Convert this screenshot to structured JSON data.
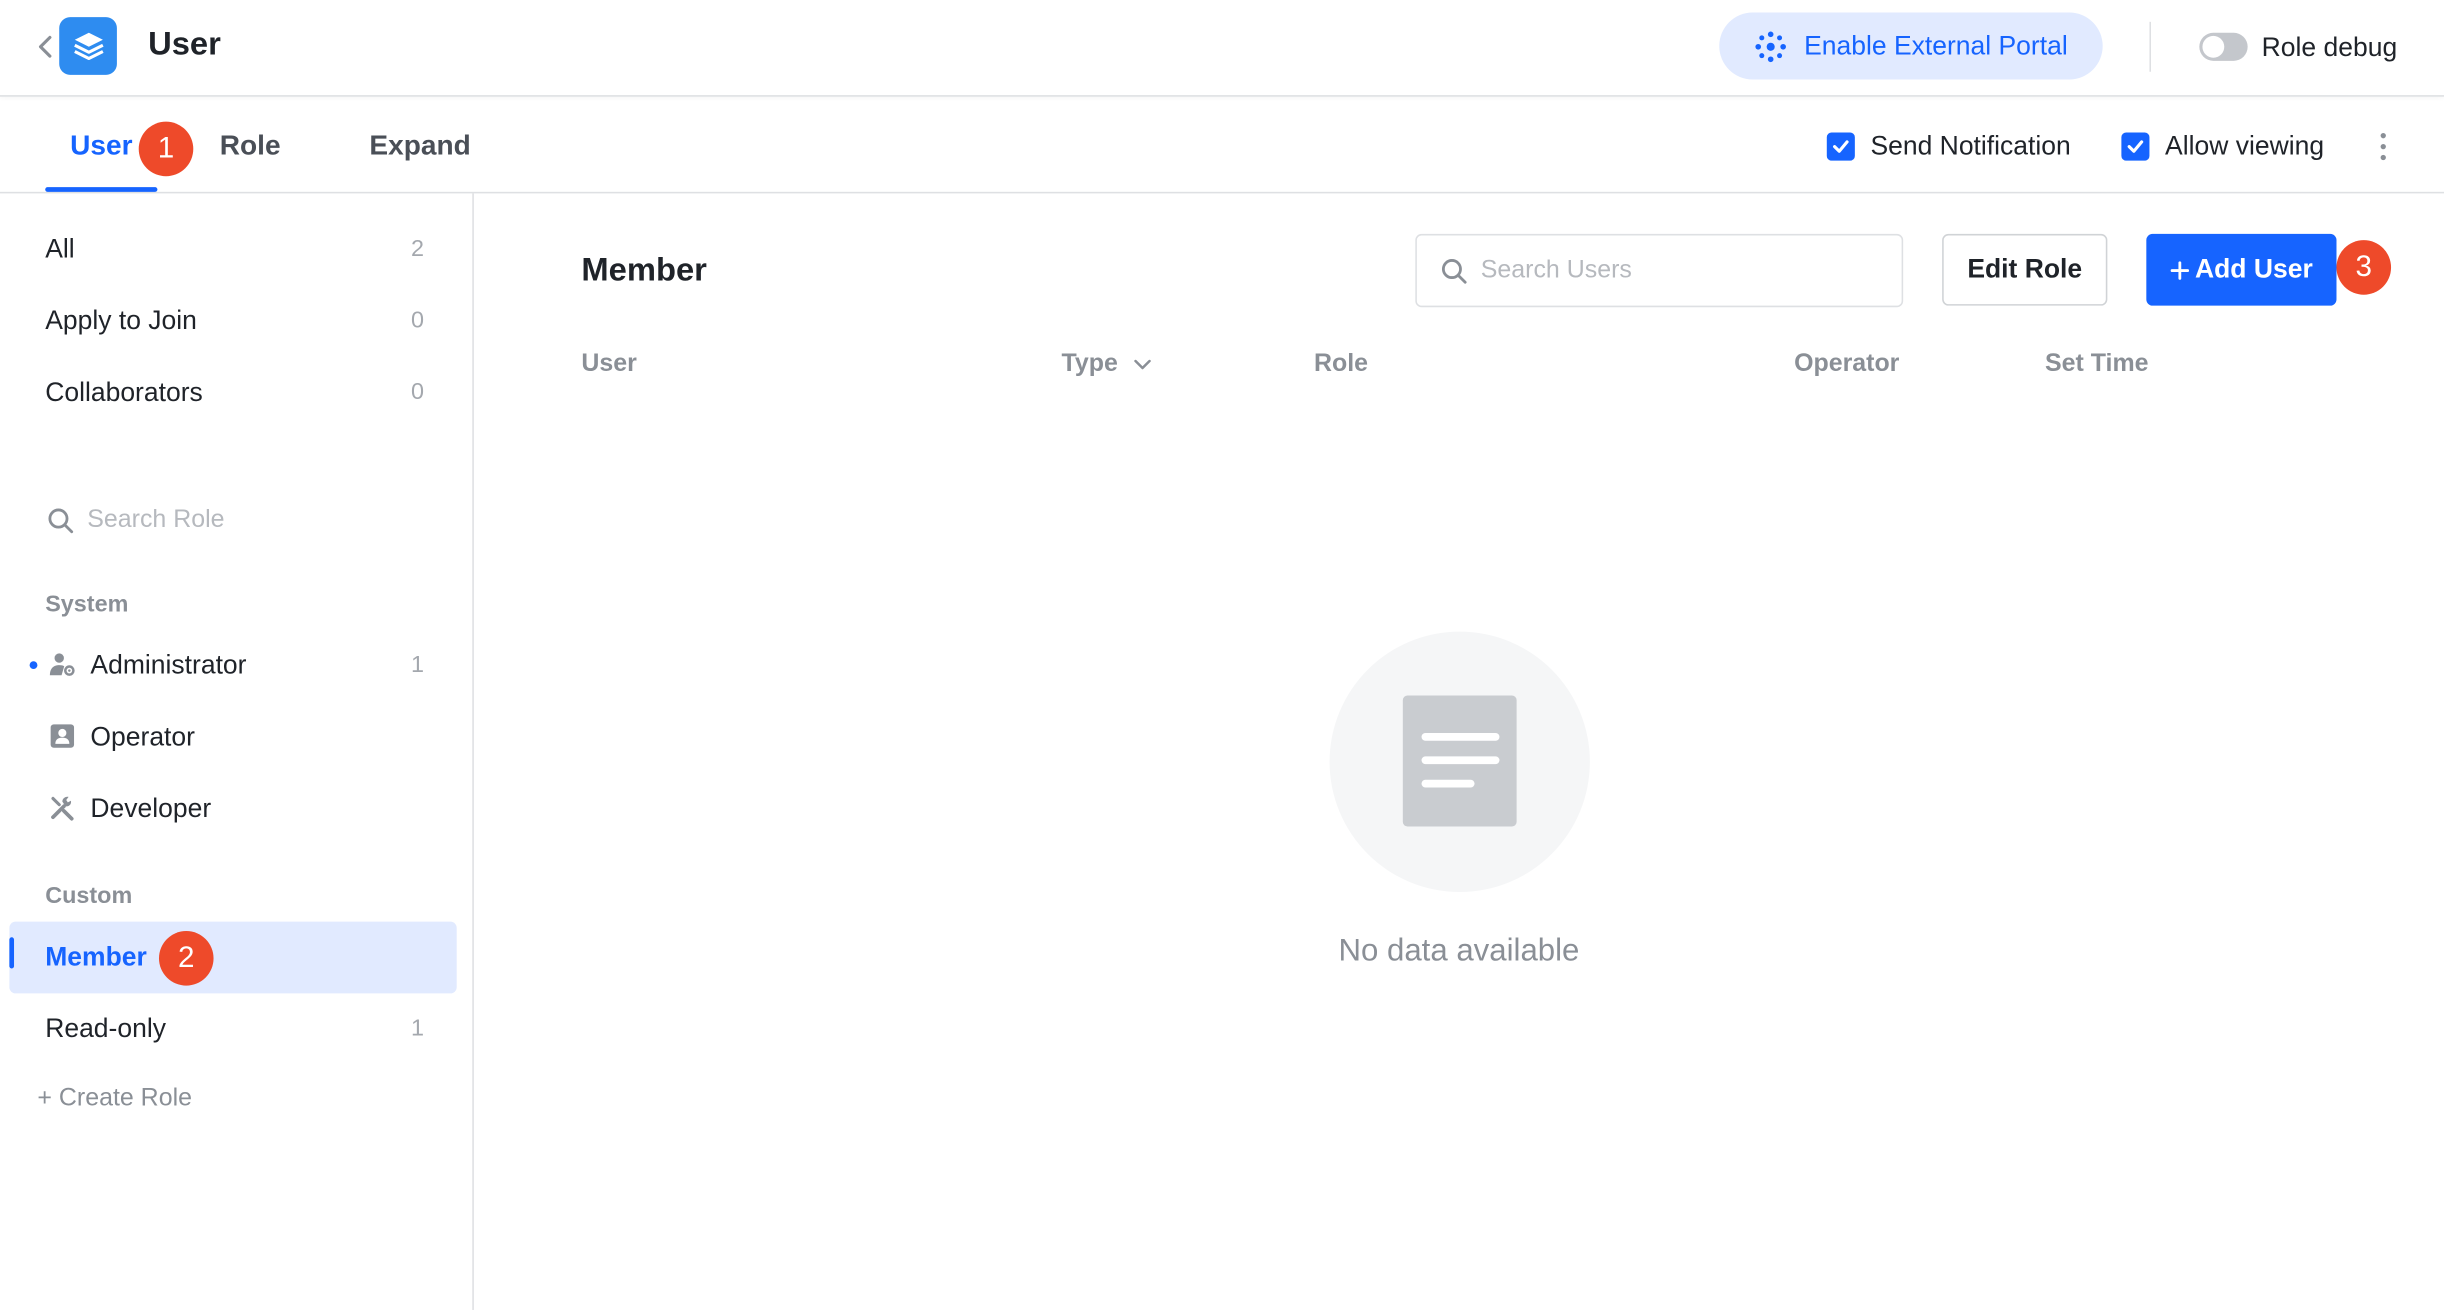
{
  "header": {
    "title": "User",
    "back_icon": "chevron-left-icon",
    "app_icon": "cube-icon",
    "portal_button": "Enable External Portal",
    "portal_icon": "portal-dots-icon",
    "role_debug_label": "Role debug",
    "role_debug_on": false
  },
  "tabs": {
    "items": [
      {
        "label": "User",
        "active": true
      },
      {
        "label": "Role",
        "active": false
      },
      {
        "label": "Expand",
        "active": false
      }
    ],
    "send_notification": {
      "label": "Send Notification",
      "checked": true
    },
    "allow_viewing": {
      "label": "Allow viewing",
      "checked": true
    }
  },
  "markers": [
    "1",
    "2",
    "3"
  ],
  "sidebar": {
    "filters": [
      {
        "label": "All",
        "count": "2"
      },
      {
        "label": "Apply to Join",
        "count": "0"
      },
      {
        "label": "Collaborators",
        "count": "0"
      }
    ],
    "search_placeholder": "Search Role",
    "system_title": "System",
    "system_roles": [
      {
        "label": "Administrator",
        "count": "1",
        "icon": "user-gear-icon"
      },
      {
        "label": "Operator",
        "count": "",
        "icon": "id-card-icon"
      },
      {
        "label": "Developer",
        "count": "",
        "icon": "tools-icon"
      }
    ],
    "custom_title": "Custom",
    "custom_roles": [
      {
        "label": "Member",
        "count": "",
        "active": true
      },
      {
        "label": "Read-only",
        "count": "1",
        "active": false
      }
    ],
    "create_role": "+ Create Role"
  },
  "main": {
    "title": "Member",
    "search_placeholder": "Search Users",
    "edit_role": "Edit Role",
    "add_user": "Add User",
    "columns": [
      "User",
      "Type",
      "Role",
      "Operator",
      "Set Time"
    ],
    "empty_text": "No data available"
  },
  "colors": {
    "accent": "#1664ff",
    "marker": "#ee4a2a",
    "app_icon": "#2e8cf0"
  }
}
